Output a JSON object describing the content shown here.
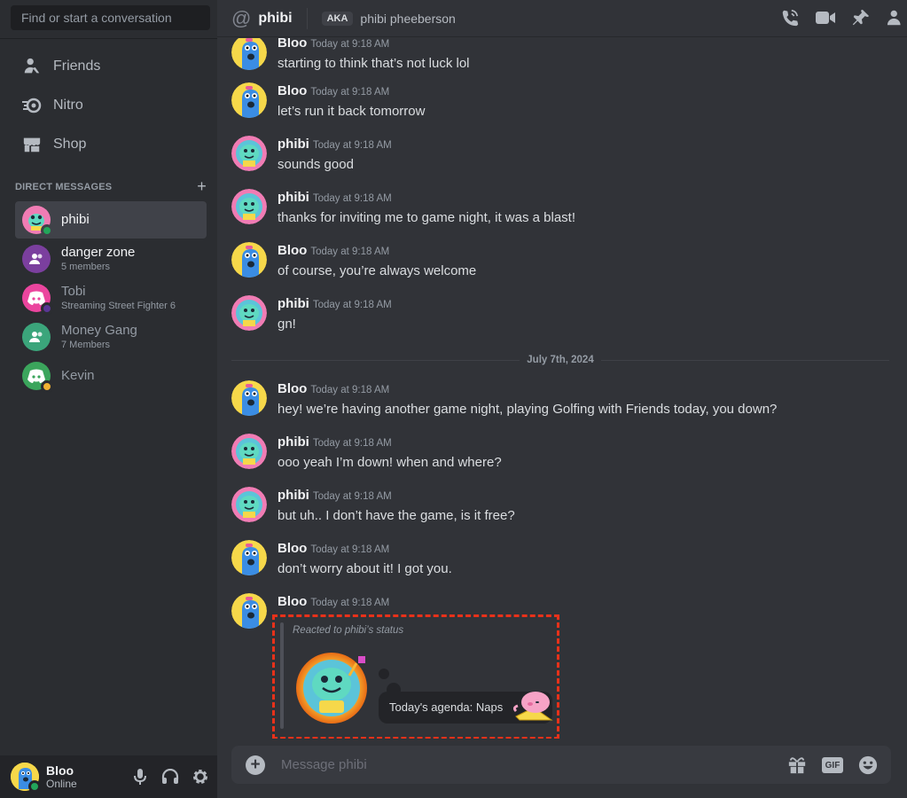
{
  "sidebar": {
    "search_placeholder": "Find or start a conversation",
    "nav": [
      {
        "label": "Friends",
        "icon": "friends-icon"
      },
      {
        "label": "Nitro",
        "icon": "nitro-icon"
      },
      {
        "label": "Shop",
        "icon": "shop-icon"
      }
    ],
    "dm_header": "DIRECT MESSAGES",
    "dms": [
      {
        "name": "phibi",
        "sub": "",
        "status": "online"
      },
      {
        "name": "danger zone",
        "sub": "5 members"
      },
      {
        "name": "Tobi",
        "sub": "Streaming Street Fighter 6",
        "status": "streaming"
      },
      {
        "name": "Money Gang",
        "sub": "7 Members"
      },
      {
        "name": "Kevin",
        "sub": "",
        "status": "idle"
      }
    ]
  },
  "user_panel": {
    "name": "Bloo",
    "status": "Online"
  },
  "header": {
    "channel": "phibi",
    "aka_badge": "AKA",
    "aka_name": "phibi pheeberson"
  },
  "messages": [
    {
      "author": "Bloo",
      "time": "Today at 9:18 AM",
      "text": "starting to think that’s not luck lol"
    },
    {
      "author": "Bloo",
      "time": "Today at 9:18 AM",
      "text": "let’s run it back tomorrow"
    },
    {
      "author": "phibi",
      "time": "Today at 9:18 AM",
      "text": "sounds good"
    },
    {
      "author": "phibi",
      "time": "Today at 9:18 AM",
      "text": "thanks for inviting me to game night, it was a blast!"
    },
    {
      "author": "Bloo",
      "time": "Today at 9:18 AM",
      "text": "of course, you’re always welcome"
    },
    {
      "author": "phibi",
      "time": "Today at 9:18 AM",
      "text": "gn!"
    },
    {
      "author": "Bloo",
      "time": "Today at 9:18 AM",
      "text": "hey! we’re having another game night, playing Golfing with Friends today, you down?"
    },
    {
      "author": "phibi",
      "time": "Today at 9:18 AM",
      "text": "ooo yeah I’m down! when and where?"
    },
    {
      "author": "phibi",
      "time": "Today at 9:18 AM",
      "text": "but uh.. I don’t have the game, is it free?"
    },
    {
      "author": "Bloo",
      "time": "Today at 9:18 AM",
      "text": "don’t worry about it! I got you."
    },
    {
      "author": "Bloo",
      "time": "Today at 9:18 AM",
      "text": ""
    }
  ],
  "date_divider": "July 7th, 2024",
  "reaction": {
    "label": "Reacted to phibi’s status",
    "status_text": "Today's agenda: Naps"
  },
  "composer": {
    "placeholder": "Message phibi",
    "gif_label": "GIF"
  },
  "colors": {
    "online": "#23a55a",
    "streaming": "#593695",
    "idle": "#f0b232",
    "accent_dashed": "#e8311a"
  }
}
